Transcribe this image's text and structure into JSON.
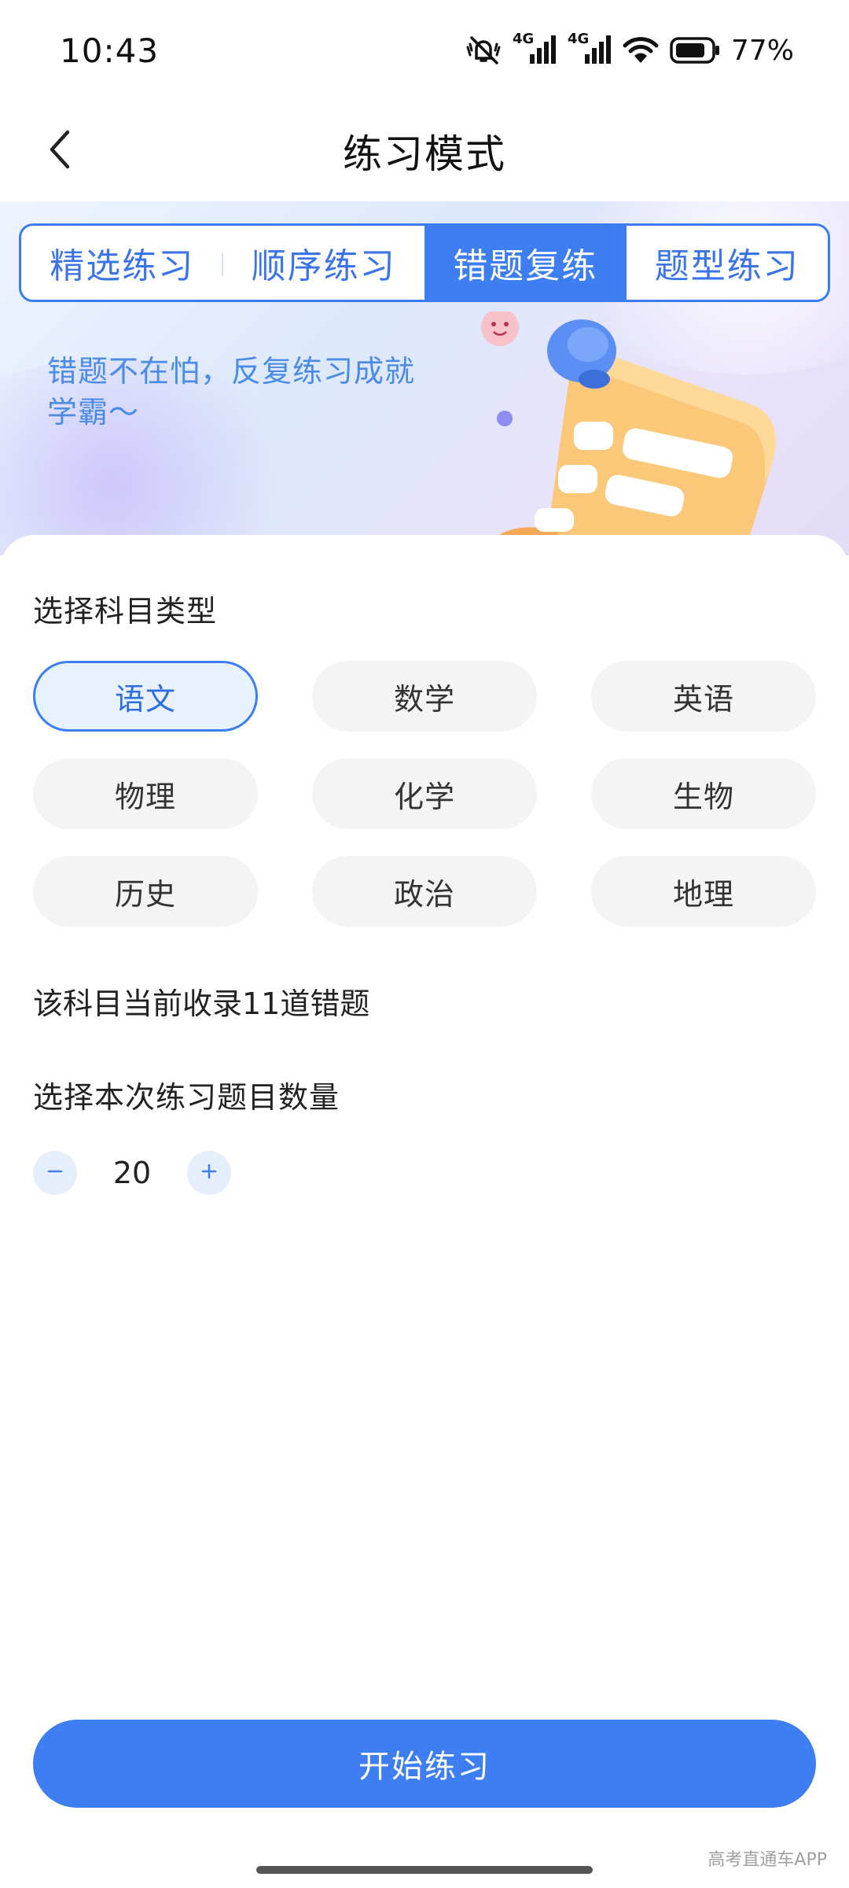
{
  "status_bar": {
    "time": "10:43",
    "network_1": "4G",
    "network_2": "4G",
    "battery": "77%",
    "icons": [
      "mute-vibrate-icon",
      "signal-4g-icon",
      "signal-4g-icon",
      "wifi-icon",
      "battery-icon"
    ]
  },
  "header": {
    "title": "练习模式",
    "back_icon": "chevron-left-icon"
  },
  "tabs": [
    {
      "label": "精选练习",
      "active": false
    },
    {
      "label": "顺序练习",
      "active": false
    },
    {
      "label": "错题复练",
      "active": true
    },
    {
      "label": "题型练习",
      "active": false
    }
  ],
  "banner": {
    "slogan": "错题不在怕，反复练习成就学霸～"
  },
  "subject_section": {
    "label": "选择科目类型",
    "subjects": [
      {
        "label": "语文",
        "selected": true
      },
      {
        "label": "数学",
        "selected": false
      },
      {
        "label": "英语",
        "selected": false
      },
      {
        "label": "物理",
        "selected": false
      },
      {
        "label": "化学",
        "selected": false
      },
      {
        "label": "生物",
        "selected": false
      },
      {
        "label": "历史",
        "selected": false
      },
      {
        "label": "政治",
        "selected": false
      },
      {
        "label": "地理",
        "selected": false
      }
    ]
  },
  "count_text": "该科目当前收录11道错题",
  "quantity_section": {
    "label": "选择本次练习题目数量",
    "value": "20",
    "decrement_icon": "minus-icon",
    "increment_icon": "plus-icon"
  },
  "start_button": {
    "label": "开始练习"
  },
  "watermark": "高考直通车APP",
  "colors": {
    "accent": "#3d7ff2",
    "selected_bg": "#e8f1fe",
    "chip_bg": "#f4f4f4"
  }
}
